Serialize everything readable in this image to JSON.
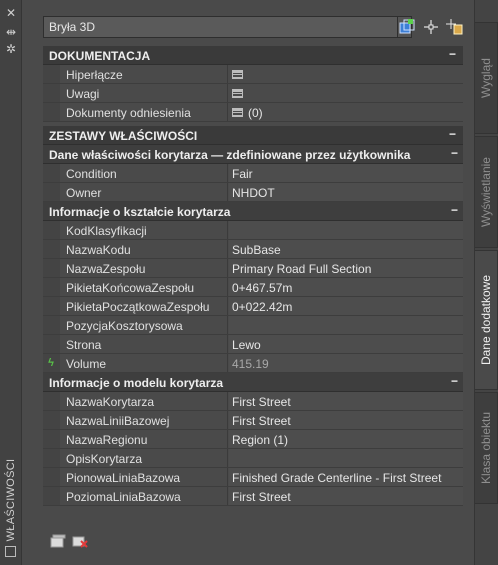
{
  "palette_title": "WŁAŚCIWOŚCI",
  "selection": {
    "value": "Bryła 3D"
  },
  "icons": {
    "toggle_pickadd": "quick-select-icon",
    "select_objects": "select-objects-icon",
    "quick_select": "pickadd-icon",
    "close": "close-icon",
    "autohide": "autohide-icon",
    "settings": "settings-icon"
  },
  "sections": {
    "dokumentacja": {
      "title": "DOKUMENTACJA",
      "rows": [
        {
          "key": "Hiperłącze",
          "value": ""
        },
        {
          "key": "Uwagi",
          "value": ""
        },
        {
          "key": "Dokumenty odniesienia",
          "value": "(0)"
        }
      ]
    },
    "zestawy": {
      "title": "ZESTAWY WŁAŚCIWOŚCI"
    },
    "dane_korytarza": {
      "title": "Dane właściwości korytarza — zdefiniowane przez użytkownika",
      "rows": [
        {
          "key": "Condition",
          "value": "Fair"
        },
        {
          "key": "Owner",
          "value": "NHDOT"
        }
      ]
    },
    "ksztalt": {
      "title": "Informacje o kształcie korytarza",
      "rows": [
        {
          "key": "KodKlasyfikacji",
          "value": ""
        },
        {
          "key": "NazwaKodu",
          "value": "SubBase"
        },
        {
          "key": "NazwaZespołu",
          "value": "Primary Road Full Section"
        },
        {
          "key": "PikietaKońcowaZespołu",
          "value": "0+467.57m"
        },
        {
          "key": "PikietaPoczątkowaZespołu",
          "value": "0+022.42m"
        },
        {
          "key": "PozycjaKosztorysowa",
          "value": ""
        },
        {
          "key": "Strona",
          "value": "Lewo"
        },
        {
          "key": "Volume",
          "value": "415.19"
        }
      ]
    },
    "model": {
      "title": "Informacje o modelu korytarza",
      "rows": [
        {
          "key": "NazwaKorytarza",
          "value": "First Street"
        },
        {
          "key": "NazwaLiniiBazowej",
          "value": "First Street"
        },
        {
          "key": "NazwaRegionu",
          "value": "Region (1)"
        },
        {
          "key": "OpisKorytarza",
          "value": ""
        },
        {
          "key": "PionowaLiniaBazowa",
          "value": "Finished Grade Centerline - First Street"
        },
        {
          "key": "PoziomaLiniaBazowa",
          "value": "First Street"
        }
      ]
    }
  },
  "collapse_symbol": "−",
  "tabs": [
    "Wygląd",
    "Wyświetlanie",
    "Dane dodatkowe",
    "Klasa obiektu"
  ],
  "active_tab": "Dane dodatkowe",
  "colors": {
    "panel_bg": "#4a4a4a",
    "category_bg": "#3a3a3a",
    "text": "#e6e6e6",
    "readonly_text": "#a8a8a8"
  }
}
